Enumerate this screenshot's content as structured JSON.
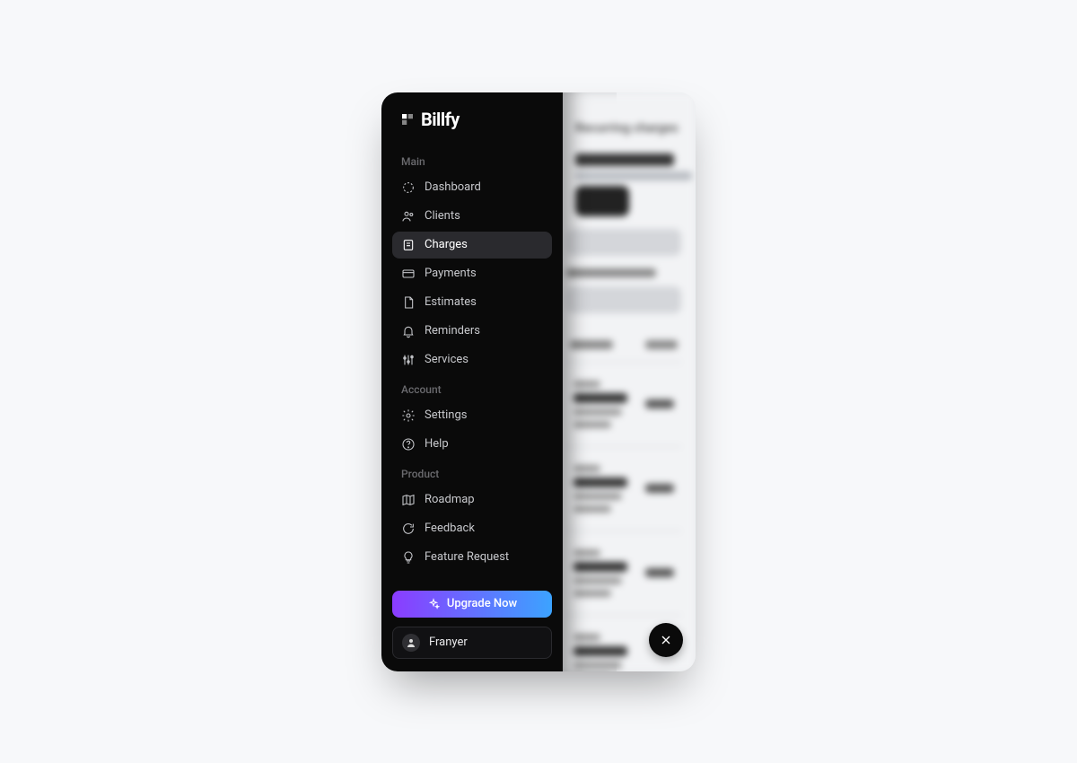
{
  "brand": {
    "name": "Billfy"
  },
  "sections": {
    "main": {
      "label": "Main",
      "items": [
        {
          "label": "Dashboard"
        },
        {
          "label": "Clients"
        },
        {
          "label": "Charges"
        },
        {
          "label": "Payments"
        },
        {
          "label": "Estimates"
        },
        {
          "label": "Reminders"
        },
        {
          "label": "Services"
        }
      ]
    },
    "account": {
      "label": "Account",
      "items": [
        {
          "label": "Settings"
        },
        {
          "label": "Help"
        }
      ]
    },
    "product": {
      "label": "Product",
      "items": [
        {
          "label": "Roadmap"
        },
        {
          "label": "Feedback"
        },
        {
          "label": "Feature Request"
        }
      ]
    }
  },
  "upgrade": {
    "label": "Upgrade Now"
  },
  "user": {
    "name": "Franyer"
  }
}
